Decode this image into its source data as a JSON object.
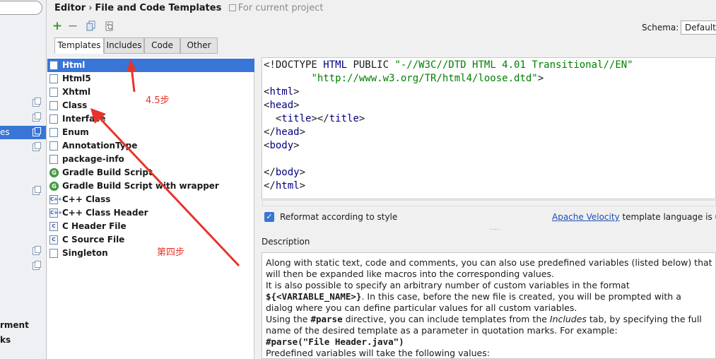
{
  "sidebar": {
    "selected_fragment": "es",
    "bottom_items": [
      "rment",
      "ks"
    ]
  },
  "header": {
    "breadcrumb_root": "Editor",
    "separator": "›",
    "breadcrumb_page": "File and Code Templates",
    "scope": "For current project"
  },
  "toolbar": {
    "add": "+",
    "remove": "−"
  },
  "schema": {
    "label": "Schema:",
    "value": "Default"
  },
  "tabs": [
    {
      "label": "Templates",
      "active": true
    },
    {
      "label": "Includes",
      "active": false
    },
    {
      "label": "Code",
      "active": false
    },
    {
      "label": "Other",
      "active": false
    }
  ],
  "templates": [
    {
      "label": "Html",
      "icon": "html-file-icon",
      "selected": true
    },
    {
      "label": "Html5",
      "icon": "html-file-icon"
    },
    {
      "label": "Xhtml",
      "icon": "xhtml-file-icon"
    },
    {
      "label": "Class",
      "icon": "java-file-icon"
    },
    {
      "label": "Interface",
      "icon": "java-file-icon"
    },
    {
      "label": "Enum",
      "icon": "java-file-icon"
    },
    {
      "label": "AnnotationType",
      "icon": "java-file-icon"
    },
    {
      "label": "package-info",
      "icon": "java-file-icon"
    },
    {
      "label": "Gradle Build Script",
      "icon": "gradle-icon"
    },
    {
      "label": "Gradle Build Script with wrapper",
      "icon": "gradle-icon"
    },
    {
      "label": "C++ Class",
      "icon": "cpp-file-icon"
    },
    {
      "label": "C++ Class Header",
      "icon": "cpp-file-icon"
    },
    {
      "label": "C Header File",
      "icon": "c-file-icon"
    },
    {
      "label": "C Source File",
      "icon": "c-file-icon"
    },
    {
      "label": "Singleton",
      "icon": "java-file-icon"
    }
  ],
  "editor": {
    "lines": [
      "<!DOCTYPE HTML PUBLIC \"-//W3C//DTD HTML 4.01 Transitional//EN\"",
      "        \"http://www.w3.org/TR/html4/loose.dtd\">",
      "<html>",
      "<head>",
      "  <title></title>",
      "</head>",
      "<body>",
      "",
      "</body>",
      "</html>"
    ]
  },
  "reformat": {
    "checked": true,
    "label": "Reformat according to style"
  },
  "velocity": {
    "link": "Apache Velocity",
    "suffix": " template language is us"
  },
  "description": {
    "title": "Description",
    "l1": "Along with static text, code and comments, you can also use predefined variables (listed below) that",
    "l2": "will then be expanded like macros into the corresponding values.",
    "l3": "It is also possible to specify an arbitrary number of custom variables in the format",
    "l4_code": "${<VARIABLE_NAME>}",
    "l4_rest": ". In this case, before the new file is created, you will be prompted with a",
    "l5": "dialog where you can define particular values for all custom variables.",
    "l6_pre": "Using the ",
    "l6_code": "#parse",
    "l6_mid": " directive, you can include templates from the ",
    "l6_em": "Includes",
    "l6_post": " tab, by specifying the full",
    "l7": "name of the desired template as a parameter in quotation marks. For example:",
    "l8_code": "#parse(\"File Header.java\")",
    "l9": "Predefined variables will take the following values:"
  },
  "annotations": {
    "step_a": "4.5步",
    "step_b": "第四步",
    "color": "#e8332a"
  }
}
